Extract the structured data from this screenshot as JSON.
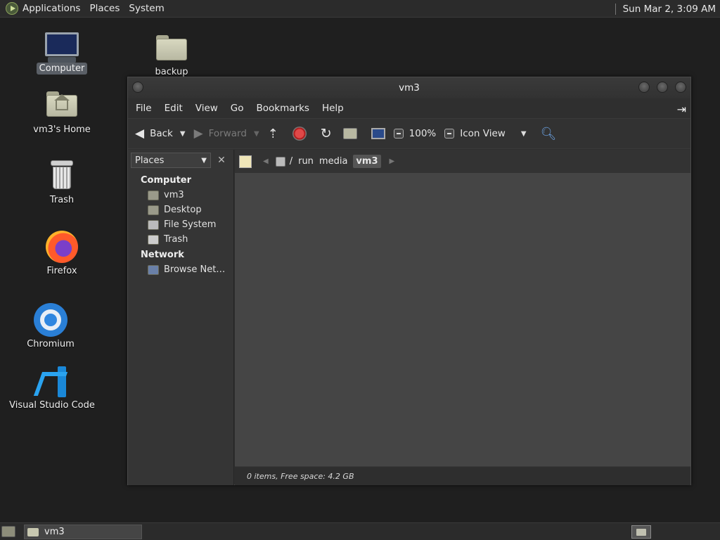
{
  "top_panel": {
    "menus": [
      "Applications",
      "Places",
      "System"
    ],
    "clock": "Sun Mar 2, 3:09 AM"
  },
  "desktop": {
    "icons": [
      {
        "label": "Computer",
        "icon": "computer-icon"
      },
      {
        "label": "backup",
        "icon": "folder-icon"
      },
      {
        "label": "vm3's Home",
        "icon": "home-folder-icon"
      },
      {
        "label": "Trash",
        "icon": "trash-icon"
      },
      {
        "label": "Firefox",
        "icon": "firefox-icon"
      },
      {
        "label": "Chromium",
        "icon": "chromium-icon"
      },
      {
        "label": "Visual Studio Code",
        "icon": "vscode-icon"
      }
    ]
  },
  "window": {
    "title": "vm3",
    "menu": [
      "File",
      "Edit",
      "View",
      "Go",
      "Bookmarks",
      "Help"
    ],
    "toolbar": {
      "back": "Back",
      "forward": "Forward",
      "zoom": "100%",
      "view_mode": "Icon View"
    },
    "sidebar": {
      "selector": "Places",
      "groups": [
        {
          "title": "Computer",
          "items": [
            "vm3",
            "Desktop",
            "File System",
            "Trash"
          ]
        },
        {
          "title": "Network",
          "items": [
            "Browse Net…"
          ]
        }
      ]
    },
    "path": {
      "root": "/",
      "segments": [
        "run",
        "media",
        "vm3"
      ]
    },
    "status": "0 items, Free space: 4.2 GB"
  },
  "taskbar": {
    "tasks": [
      "vm3"
    ]
  }
}
